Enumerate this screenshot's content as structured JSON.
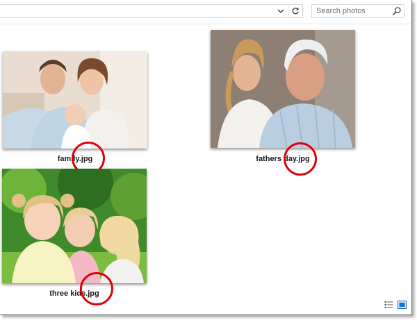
{
  "toolbar": {
    "address_dropdown_icon": "chevron-down-icon",
    "refresh_icon": "refresh-icon",
    "search_placeholder": "Search photos",
    "search_icon": "magnifier-icon"
  },
  "files": [
    {
      "name": "family.jpg",
      "thumbnail": "photo-thumbnail",
      "highlighted": true
    },
    {
      "name": "fathers day.jpg",
      "thumbnail": "photo-thumbnail",
      "highlighted": true
    },
    {
      "name": "three kids.jpg",
      "thumbnail": "photo-thumbnail",
      "highlighted": true
    }
  ],
  "statusbar": {
    "details_view_icon": "details-view-icon",
    "thumbnail_view_icon": "large-icons-view-icon"
  },
  "colors": {
    "highlight_ring": "#e0000d",
    "view_active": "#1a73c9"
  }
}
